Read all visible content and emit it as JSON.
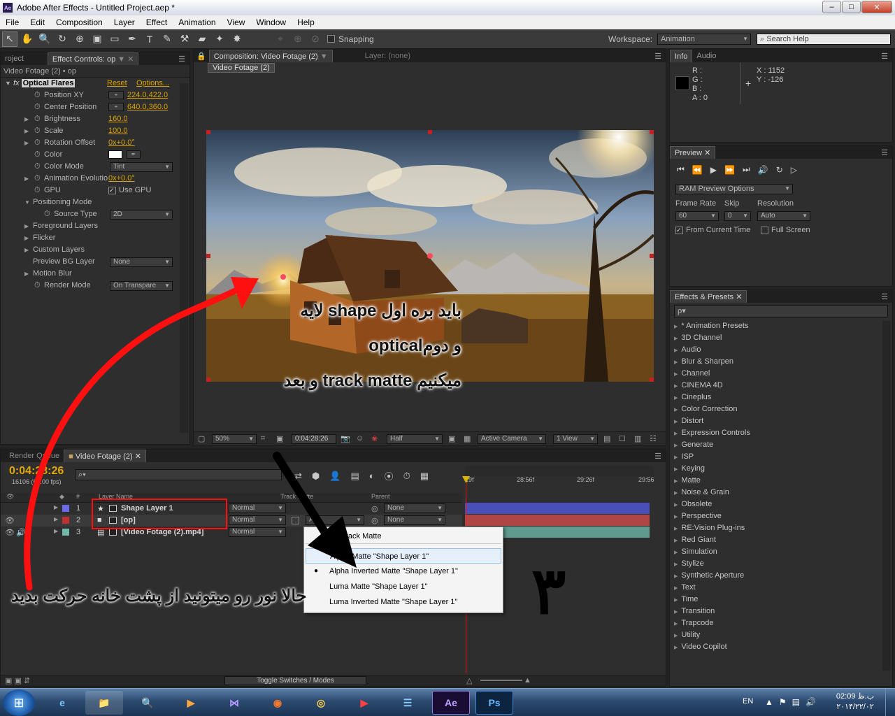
{
  "window": {
    "title": "Adobe After Effects - Untitled Project.aep *",
    "app_icon": "Ae"
  },
  "menu": [
    "File",
    "Edit",
    "Composition",
    "Layer",
    "Effect",
    "Animation",
    "View",
    "Window",
    "Help"
  ],
  "toolbar": {
    "snapping_label": "Snapping",
    "workspace_label": "Workspace:",
    "workspace_value": "Animation",
    "search_placeholder": "Search Help"
  },
  "effect_controls": {
    "tab_project": "roject",
    "tab_label": "Effect Controls: op",
    "subtitle": "Video Fotage (2) • op",
    "effect_name": "Optical Flares",
    "reset": "Reset",
    "options": "Options...",
    "params": [
      {
        "label": "Position XY",
        "value": "224.0,422.0"
      },
      {
        "label": "Center Position",
        "value": "640.0,360.0"
      },
      {
        "label": "Brightness",
        "value": "160.0"
      },
      {
        "label": "Scale",
        "value": "100.0"
      },
      {
        "label": "Rotation Offset",
        "value": "0x+0.0°"
      },
      {
        "label": "Color",
        "value": ""
      },
      {
        "label": "Color Mode",
        "value": "Tint"
      },
      {
        "label": "Animation Evolutio",
        "value": "0x+0.0°"
      },
      {
        "label": "GPU",
        "value": "Use GPU"
      },
      {
        "label": "Positioning Mode",
        "value": ""
      },
      {
        "label": "Source Type",
        "value": "2D"
      },
      {
        "label": "Foreground Layers",
        "value": ""
      },
      {
        "label": "Flicker",
        "value": ""
      },
      {
        "label": "Custom Layers",
        "value": ""
      },
      {
        "label": "Preview BG Layer",
        "value": "None"
      },
      {
        "label": "Motion Blur",
        "value": ""
      },
      {
        "label": "Render Mode",
        "value": "On Transpare"
      }
    ]
  },
  "composition": {
    "tab_label": "Composition: Video Fotage (2)",
    "layer_tab": "Layer: (none)",
    "crumb": "Video Fotage (2)",
    "zoom": "50%",
    "timecode": "0:04:28:26",
    "resolution": "Half",
    "camera": "Active Camera",
    "views": "1 View",
    "overlay_lines": [
      "لایه shape باید بره اول",
      "opticalو دوم",
      "و بعد track matte میکنیم"
    ]
  },
  "info": {
    "tab": "Info",
    "tab2": "Audio",
    "r": "R :",
    "g": "G :",
    "b": "B :",
    "a": "A : 0",
    "x": "X : 1152",
    "y": "Y : -126"
  },
  "preview": {
    "tab": "Preview",
    "ram_options": "RAM Preview Options",
    "frame_rate_label": "Frame Rate",
    "skip_label": "Skip",
    "resolution_label": "Resolution",
    "frame_rate": "60",
    "skip": "0",
    "resolution": "Auto",
    "from_current": "From Current Time",
    "full_screen": "Full Screen"
  },
  "effects_presets": {
    "tab": "Effects & Presets",
    "search_placeholder": "ρ▾",
    "items": [
      "* Animation Presets",
      "3D Channel",
      "Audio",
      "Blur & Sharpen",
      "Channel",
      "CINEMA 4D",
      "Cineplus",
      "Color Correction",
      "Distort",
      "Expression Controls",
      "Generate",
      "ISP",
      "Keying",
      "Matte",
      "Noise & Grain",
      "Obsolete",
      "Perspective",
      "RE:Vision Plug-ins",
      "Red Giant",
      "Simulation",
      "Stylize",
      "Synthetic Aperture",
      "Text",
      "Time",
      "Transition",
      "Trapcode",
      "Utility",
      "Video Copilot"
    ]
  },
  "timeline": {
    "tab_render": "Render Queue",
    "tab_comp": "Video Fotage (2)",
    "timecode": "0:04:28:26",
    "fps": "16106 (60.00 fps)",
    "col_layer": "Layer Name",
    "col_track": "Track Matte",
    "col_parent": "Parent",
    "ruler": [
      "29f",
      "28:56f",
      "29:26f",
      "29:56"
    ],
    "layers": [
      {
        "num": "1",
        "name": "Shape Layer 1",
        "mode": "Normal",
        "trkmat": "",
        "parent": "None",
        "color": "#6a6ae8"
      },
      {
        "num": "2",
        "name": "[op]",
        "mode": "Normal",
        "trkmat": "A...",
        "parent": "None",
        "color": "#c03030"
      },
      {
        "num": "3",
        "name": "[Video Fotage (2).mp4]",
        "mode": "Normal",
        "trkmat": "",
        "parent": "",
        "color": "#70b8a8"
      }
    ],
    "toggle_label": "Toggle Switches / Modes",
    "menu_items": [
      "No Track Matte",
      "Alpha Matte \"Shape Layer 1\"",
      "Alpha Inverted Matte \"Shape Layer 1\"",
      "Luma Matte \"Shape Layer 1\"",
      "Luma Inverted Matte \"Shape Layer 1\""
    ],
    "overlay_text": "حالا نور رو میتونید از پشت خانه حرکت بدید",
    "overlay_number": "۳"
  },
  "taskbar": {
    "lang": "EN",
    "time": "02:09 ب.ظ",
    "date": "۲۰۱۴/۲۲/۰۲"
  },
  "colors": {
    "accent_gold": "#d9a400",
    "annotation_red": "#ff1010",
    "annotation_black": "#000000"
  }
}
